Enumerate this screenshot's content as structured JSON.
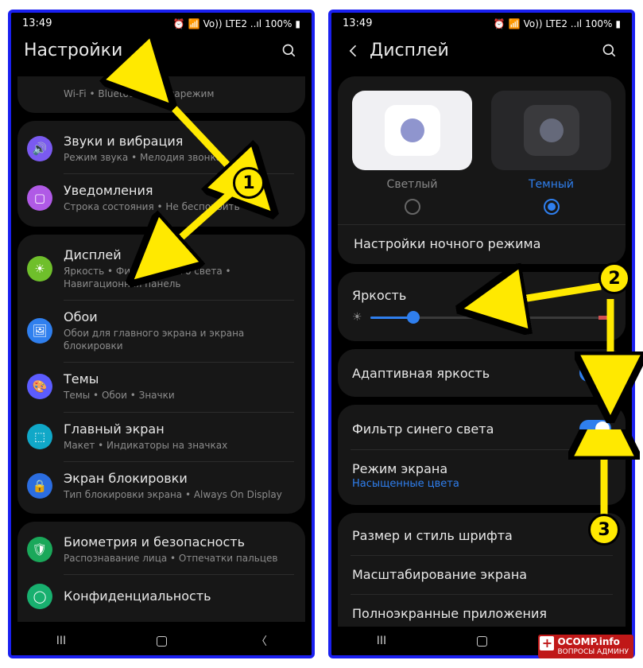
{
  "statusbar": {
    "time": "13:49",
    "battery": "100%",
    "net": "Vo)) LTE2 ..ıl"
  },
  "left": {
    "title": "Настройки",
    "row0": {
      "sub": "Wi-Fi  •  Bluetooth  •  Авиарежим"
    },
    "group1": {
      "sound": {
        "title": "Звуки и вибрация",
        "sub": "Режим звука  •  Мелодия звонка"
      },
      "notif": {
        "title": "Уведомления",
        "sub": "Строка состояния  •  Не беспокоить"
      }
    },
    "group2": {
      "display": {
        "title": "Дисплей",
        "sub": "Яркость  •  Фильтр синего света  •  Навигационная панель"
      },
      "wallpaper": {
        "title": "Обои",
        "sub": "Обои для главного экрана и экрана блокировки"
      },
      "themes": {
        "title": "Темы",
        "sub": "Темы  •  Обои  •  Значки"
      },
      "home": {
        "title": "Главный экран",
        "sub": "Макет  •  Индикаторы на значках"
      },
      "lock": {
        "title": "Экран блокировки",
        "sub": "Тип блокировки экрана  •  Always On Display"
      }
    },
    "group3": {
      "bio": {
        "title": "Биометрия и безопасность",
        "sub": "Распознавание лица  •  Отпечатки пальцев"
      },
      "priv": {
        "title": "Конфиденциальность"
      }
    }
  },
  "right": {
    "title": "Дисплей",
    "theme": {
      "light": "Светлый",
      "dark": "Темный",
      "dark_settings": "Настройки ночного режима"
    },
    "brightness": {
      "label": "Яркость"
    },
    "adaptive": {
      "label": "Адаптивная яркость"
    },
    "bluefilter": {
      "label": "Фильтр синего света"
    },
    "screenmode": {
      "label": "Режим экрана",
      "sub": "Насыщенные цвета"
    },
    "fontsize": {
      "label": "Размер и стиль шрифта"
    },
    "zoom": {
      "label": "Масштабирование экрана"
    },
    "fullscreen": {
      "label": "Полноэкранные приложения"
    }
  },
  "steps": {
    "n1": "1",
    "n2": "2",
    "n3": "3"
  },
  "watermark": {
    "brand": "OCOMP.info",
    "sub": "ВОПРОСЫ АДМИНУ"
  }
}
